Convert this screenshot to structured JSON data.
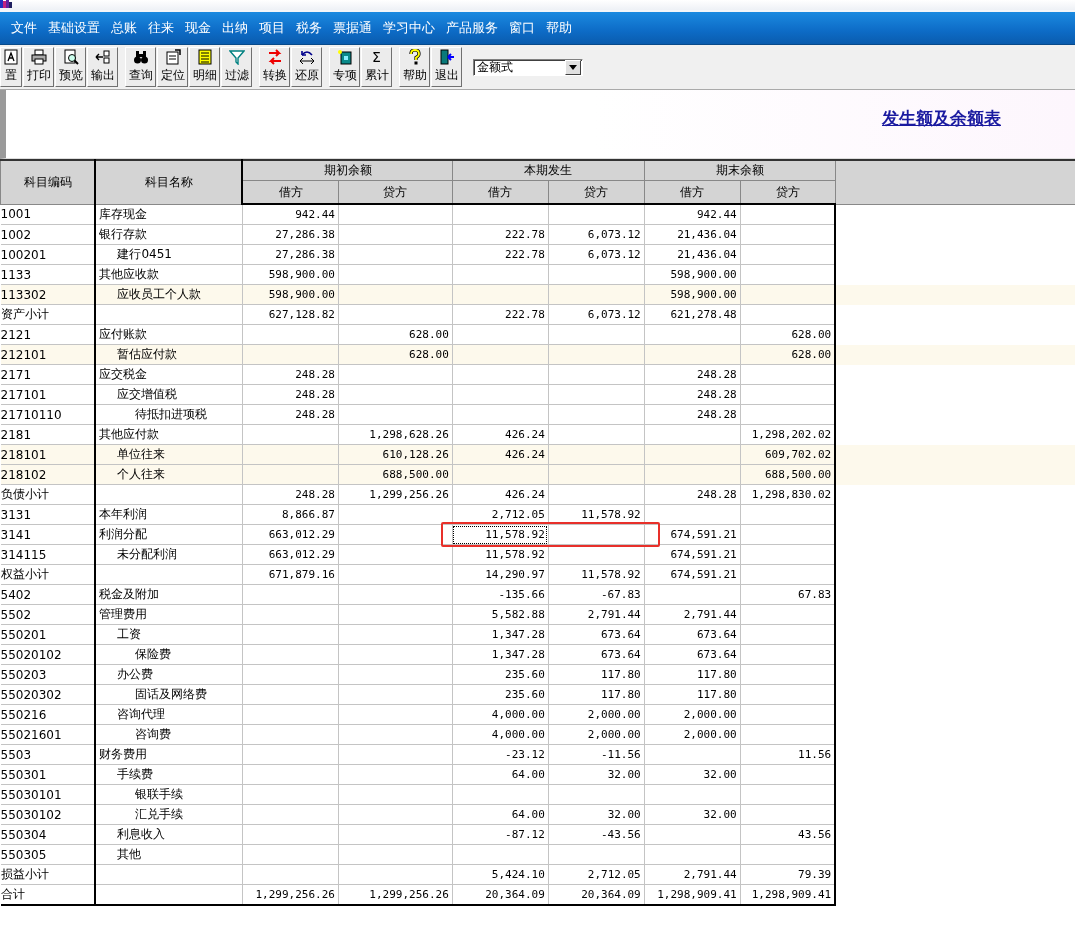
{
  "menu": [
    "文件",
    "基础设置",
    "总账",
    "往来",
    "现金",
    "出纳",
    "项目",
    "税务",
    "票据通",
    "学习中心",
    "产品服务",
    "窗口",
    "帮助"
  ],
  "toolbar": {
    "groups": [
      [
        {
          "label": "置"
        },
        {
          "label": "打印"
        },
        {
          "label": "预览"
        },
        {
          "label": "输出"
        }
      ],
      [
        {
          "label": "查询"
        },
        {
          "label": "定位"
        },
        {
          "label": "明细"
        },
        {
          "label": "过滤"
        }
      ],
      [
        {
          "label": "转换"
        },
        {
          "label": "还原"
        }
      ],
      [
        {
          "label": "专项"
        },
        {
          "label": "累计",
          "glyph": "Σ"
        }
      ],
      [
        {
          "label": "帮助"
        },
        {
          "label": "退出"
        }
      ]
    ],
    "dropdown": {
      "value": "金额式"
    }
  },
  "report": {
    "title": "发生额及余额表"
  },
  "table": {
    "columns": [
      {
        "label": "科目编码"
      },
      {
        "label": "科目名称"
      }
    ],
    "groups": [
      {
        "label": "期初余额",
        "sub": [
          {
            "label": "借方"
          },
          {
            "label": "贷方"
          }
        ]
      },
      {
        "label": "本期发生",
        "sub": [
          {
            "label": "借方"
          },
          {
            "label": "贷方"
          }
        ]
      },
      {
        "label": "期末余额",
        "sub": [
          {
            "label": "借方"
          },
          {
            "label": "贷方"
          }
        ]
      }
    ],
    "rows": [
      {
        "code": "1001",
        "name": "库存现金",
        "cells": [
          {
            "text": "942.44"
          },
          {},
          {},
          {},
          {
            "text": "942.44"
          },
          {}
        ],
        "highlighted": false
      },
      {
        "code": "1002",
        "name": "银行存款",
        "cells": [
          {
            "text": "27,286.38"
          },
          {},
          {
            "text": "222.78"
          },
          {
            "text": "6,073.12"
          },
          {
            "text": "21,436.04"
          },
          {}
        ],
        "highlighted": false,
        "children": [
          {
            "code": "100201",
            "name": "建行0451",
            "cells": [
              {
                "text": "27,286.38"
              },
              {},
              {
                "text": "222.78"
              },
              {
                "text": "6,073.12"
              },
              {
                "text": "21,436.04"
              },
              {}
            ],
            "highlighted": false
          }
        ]
      },
      {
        "code": "1133",
        "name": "其他应收款",
        "cells": [
          {
            "text": "598,900.00"
          },
          {},
          {},
          {},
          {
            "text": "598,900.00"
          },
          {}
        ],
        "highlighted": false,
        "children": [
          {
            "code": "113302",
            "name": "应收员工个人款",
            "cells": [
              {
                "text": "598,900.00"
              },
              {},
              {},
              {},
              {
                "text": "598,900.00"
              },
              {}
            ],
            "highlighted": true
          }
        ]
      },
      {
        "code": "资产小计",
        "cells": [
          {
            "text": "627,128.82"
          },
          {},
          {
            "text": "222.78"
          },
          {
            "text": "6,073.12"
          },
          {
            "text": "621,278.48"
          },
          {}
        ],
        "highlighted": false
      },
      {
        "code": "2121",
        "name": "应付账款",
        "cells": [
          {},
          {
            "text": "628.00"
          },
          {},
          {},
          {},
          {
            "text": "628.00"
          }
        ],
        "highlighted": false,
        "children": [
          {
            "code": "212101",
            "name": "暂估应付款",
            "cells": [
              {},
              {
                "text": "628.00"
              },
              {},
              {},
              {},
              {
                "text": "628.00"
              }
            ],
            "highlighted": true
          }
        ]
      },
      {
        "code": "2171",
        "name": "应交税金",
        "cells": [
          {
            "text": "248.28"
          },
          {},
          {},
          {},
          {
            "text": "248.28"
          },
          {}
        ],
        "highlighted": false,
        "children": [
          {
            "code": "217101",
            "name": "应交增值税",
            "cells": [
              {
                "text": "248.28"
              },
              {},
              {},
              {},
              {
                "text": "248.28"
              },
              {}
            ],
            "highlighted": false,
            "children": [
              {
                "code": "21710110",
                "name": "待抵扣进项税",
                "cells": [
                  {
                    "text": "248.28"
                  },
                  {},
                  {},
                  {},
                  {
                    "text": "248.28"
                  },
                  {}
                ],
                "highlighted": false
              }
            ]
          }
        ]
      },
      {
        "code": "2181",
        "name": "其他应付款",
        "cells": [
          {},
          {
            "text": "1,298,628.26"
          },
          {
            "text": "426.24"
          },
          {},
          {},
          {
            "text": "1,298,202.02"
          }
        ],
        "highlighted": false,
        "children": [
          {
            "code": "218101",
            "name": "单位往来",
            "cells": [
              {},
              {
                "text": "610,128.26"
              },
              {
                "text": "426.24"
              },
              {},
              {},
              {
                "text": "609,702.02"
              }
            ],
            "highlighted": true
          },
          {
            "code": "218102",
            "name": "个人往来",
            "cells": [
              {},
              {
                "text": "688,500.00"
              },
              {},
              {},
              {},
              {
                "text": "688,500.00"
              }
            ],
            "highlighted": true
          }
        ]
      },
      {
        "code": "负债小计",
        "cells": [
          {
            "text": "248.28"
          },
          {
            "text": "1,299,256.26"
          },
          {
            "text": "426.24"
          },
          {},
          {
            "text": "248.28"
          },
          {
            "text": "1,298,830.02"
          }
        ],
        "highlighted": false
      },
      {
        "code": "3131",
        "name": "本年利润",
        "cells": [
          {
            "text": "8,866.87"
          },
          {},
          {
            "text": "2,712.05"
          },
          {
            "text": "11,578.92"
          },
          {},
          {}
        ],
        "highlighted": false
      },
      {
        "code": "3141",
        "name": "利润分配",
        "cells": [
          {
            "text": "663,012.29",
            "selected": false
          },
          {
            "selected": false
          },
          {
            "text": "11,578.92",
            "selected": true
          },
          {
            "selected": false
          },
          {
            "text": "674,591.21",
            "selected": false
          },
          {
            "selected": false
          }
        ],
        "highlighted": false,
        "children": [
          {
            "code": "314115",
            "name": "未分配利润",
            "cells": [
              {
                "text": "663,012.29"
              },
              {},
              {
                "text": "11,578.92"
              },
              {},
              {
                "text": "674,591.21"
              },
              {}
            ],
            "highlighted": false
          }
        ]
      },
      {
        "code": "权益小计",
        "cells": [
          {
            "text": "671,879.16"
          },
          {},
          {
            "text": "14,290.97"
          },
          {
            "text": "11,578.92"
          },
          {
            "text": "674,591.21"
          },
          {}
        ],
        "highlighted": false
      },
      {
        "code": "5402",
        "name": "税金及附加",
        "cells": [
          {},
          {},
          {
            "text": "-135.66"
          },
          {
            "text": "-67.83"
          },
          {},
          {
            "text": "67.83"
          }
        ],
        "highlighted": false
      },
      {
        "code": "5502",
        "name": "管理费用",
        "cells": [
          {},
          {},
          {
            "text": "5,582.88"
          },
          {
            "text": "2,791.44"
          },
          {
            "text": "2,791.44"
          },
          {}
        ],
        "highlighted": false,
        "children": [
          {
            "code": "550201",
            "name": "工资",
            "cells": [
              {},
              {},
              {
                "text": "1,347.28"
              },
              {
                "text": "673.64"
              },
              {
                "text": "673.64"
              },
              {}
            ],
            "highlighted": false,
            "children": [
              {
                "code": "55020102",
                "name": "保险费",
                "cells": [
                  {},
                  {},
                  {
                    "text": "1,347.28"
                  },
                  {
                    "text": "673.64"
                  },
                  {
                    "text": "673.64"
                  },
                  {}
                ],
                "highlighted": false
              }
            ]
          },
          {
            "code": "550203",
            "name": "办公费",
            "cells": [
              {},
              {},
              {
                "text": "235.60"
              },
              {
                "text": "117.80"
              },
              {
                "text": "117.80"
              },
              {}
            ],
            "highlighted": false,
            "children": [
              {
                "code": "55020302",
                "name": "固话及网络费",
                "cells": [
                  {},
                  {},
                  {
                    "text": "235.60"
                  },
                  {
                    "text": "117.80"
                  },
                  {
                    "text": "117.80"
                  },
                  {}
                ],
                "highlighted": false
              }
            ]
          },
          {
            "code": "550216",
            "name": "咨询代理",
            "cells": [
              {},
              {},
              {
                "text": "4,000.00"
              },
              {
                "text": "2,000.00"
              },
              {
                "text": "2,000.00"
              },
              {}
            ],
            "highlighted": false,
            "children": [
              {
                "code": "55021601",
                "name": "咨询费",
                "cells": [
                  {},
                  {},
                  {
                    "text": "4,000.00"
                  },
                  {
                    "text": "2,000.00"
                  },
                  {
                    "text": "2,000.00"
                  },
                  {}
                ],
                "highlighted": false
              }
            ]
          }
        ]
      },
      {
        "code": "5503",
        "name": "财务费用",
        "cells": [
          {},
          {},
          {
            "text": "-23.12"
          },
          {
            "text": "-11.56"
          },
          {},
          {
            "text": "11.56"
          }
        ],
        "highlighted": false,
        "children": [
          {
            "code": "550301",
            "name": "手续费",
            "cells": [
              {},
              {},
              {
                "text": "64.00"
              },
              {
                "text": "32.00"
              },
              {
                "text": "32.00"
              },
              {}
            ],
            "highlighted": false,
            "children": [
              {
                "code": "55030101",
                "name": "银联手续",
                "highlighted": false
              },
              {
                "code": "55030102",
                "name": "汇兑手续",
                "cells": [
                  {},
                  {},
                  {
                    "text": "64.00"
                  },
                  {
                    "text": "32.00"
                  },
                  {
                    "text": "32.00"
                  },
                  {}
                ],
                "highlighted": false
              }
            ]
          },
          {
            "code": "550304",
            "name": "利息收入",
            "cells": [
              {},
              {},
              {
                "text": "-87.12"
              },
              {
                "text": "-43.56"
              },
              {},
              {
                "text": "43.56"
              }
            ],
            "highlighted": false
          },
          {
            "code": "550305",
            "name": "其他",
            "highlighted": false
          }
        ]
      },
      {
        "code": "损益小计",
        "cells": [
          {},
          {},
          {
            "text": "5,424.10"
          },
          {
            "text": "2,712.05"
          },
          {
            "text": "2,791.44"
          },
          {
            "text": "79.39"
          }
        ],
        "highlighted": false
      },
      {
        "code": "合计",
        "cells": [
          {
            "text": "1,299,256.26"
          },
          {
            "text": "1,299,256.26"
          },
          {
            "text": "20,364.09"
          },
          {
            "text": "20,364.09"
          },
          {
            "text": "1,298,909.41"
          },
          {
            "text": "1,298,909.41"
          }
        ],
        "highlighted": false
      }
    ]
  }
}
